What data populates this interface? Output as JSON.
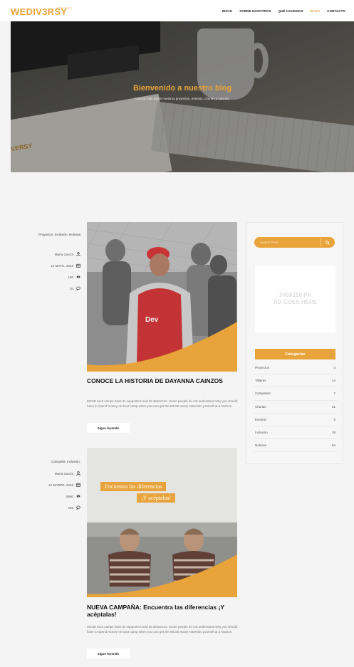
{
  "header": {
    "logo": "WEDIV3RSY",
    "logo_tagline": "inspiring\ndiversity",
    "nav": [
      {
        "label": "INICIO",
        "active": false
      },
      {
        "label": "SOBRE NOSOTROS",
        "active": false
      },
      {
        "label": "QUÉ HACEMOS",
        "active": false
      },
      {
        "label": "BLOG",
        "active": true
      },
      {
        "label": "CONTACTO",
        "active": false
      }
    ]
  },
  "hero": {
    "title": "Bienvenido a nuestro blog",
    "subtitle": "Conoce más sobre nuestros proyectos, eventos, charlas y noticias."
  },
  "posts": [
    {
      "categories": "Proyectos, Inclusión, Noticias",
      "author": "María García",
      "date": "12 MAYO, 2018",
      "views": "100",
      "comments": "04",
      "title": "CONOCE LA HISTORIA DE DAYANNA CAINZOS",
      "body": "MCSE boot camps have its supporters and its detractors. Some people do not understand why you should have to spend money on boot camp when you can get the MCSE study materials yourself at a fraction.",
      "button": "Sigue leyendo"
    },
    {
      "categories": "Campaña, Inclusión,",
      "author": "María García",
      "date": "12 MARZO, 2018",
      "views": "5560",
      "comments": "289",
      "title": "NUEVA CAMPAÑA: Encuentra las diferencias ¡Y acéptalas!",
      "body": "MCSE boot camps have its supporters and its detractors. Some people do not understand why you should have to spend money on boot camp when you can get the MCSE study materials yourself at a fraction.",
      "button": "Sigue leyendo",
      "image_caption_1": "Encuentra las diferencias",
      "image_caption_2": "¡Y acéptalas!"
    }
  ],
  "sidebar": {
    "search_placeholder": "Search Posts",
    "ad_line1": "300X250 PX",
    "ad_line2": "AD GOES HERE",
    "categories_title": "Categorías",
    "categories": [
      {
        "name": "Proyectos",
        "count": "3"
      },
      {
        "name": "Talleres",
        "count": "24"
      },
      {
        "name": "Campañas",
        "count": "2"
      },
      {
        "name": "Charlas",
        "count": "51"
      },
      {
        "name": "Eventos",
        "count": "6"
      },
      {
        "name": "Inclusión",
        "count": "28"
      },
      {
        "name": "Noticias",
        "count": "84"
      }
    ]
  },
  "colors": {
    "accent": "#e8a33a"
  }
}
